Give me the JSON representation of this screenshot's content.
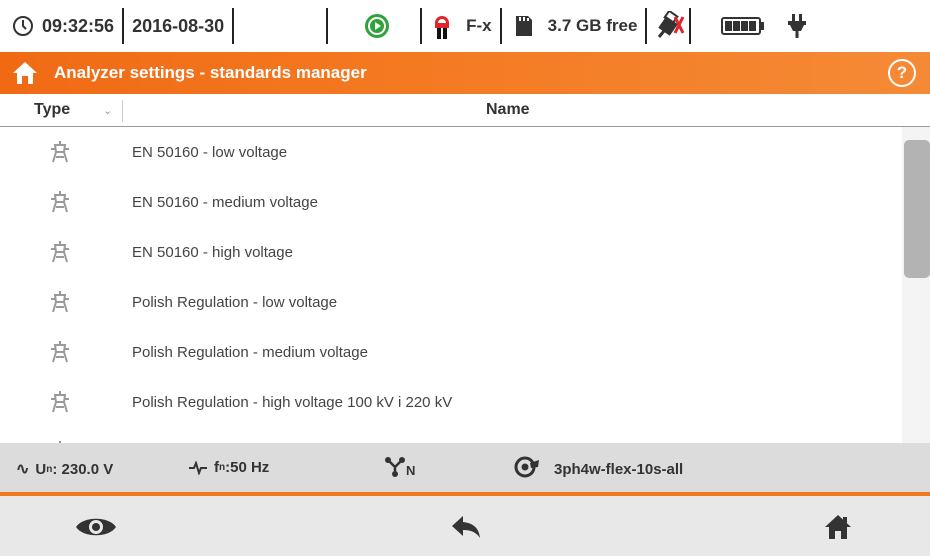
{
  "status": {
    "time": "09:32:56",
    "date": "2016-08-30",
    "clamp_label": "F-x",
    "storage": "3.7 GB free",
    "icons": [
      "clock-icon",
      "record-status-icon",
      "clamp-icon",
      "sd-card-icon",
      "usb-disconnected-icon",
      "battery-icon",
      "power-plug-icon"
    ]
  },
  "header": {
    "title": "Analyzer settings - standards manager",
    "help": "?"
  },
  "table": {
    "col_type": "Type",
    "col_name": "Name",
    "rows": [
      {
        "name": "EN 50160 - low voltage"
      },
      {
        "name": "EN 50160 - medium voltage"
      },
      {
        "name": "EN 50160 - high voltage"
      },
      {
        "name": "Polish Regulation - low voltage"
      },
      {
        "name": "Polish Regulation - medium voltage"
      },
      {
        "name": "Polish Regulation - high voltage 100 kV i 220 kV"
      }
    ]
  },
  "infobar": {
    "un_prefix": "U",
    "un_sub": "n",
    "un_value": ": 230.0 V",
    "fn_prefix": "f",
    "fn_sub": "n",
    "fn_value": ":50 Hz",
    "network_sub": "N",
    "config": "3ph4w-flex-10s-all"
  },
  "colors": {
    "accent": "#f07a22",
    "header_start": "#f06a14",
    "header_end": "#f58a36"
  }
}
